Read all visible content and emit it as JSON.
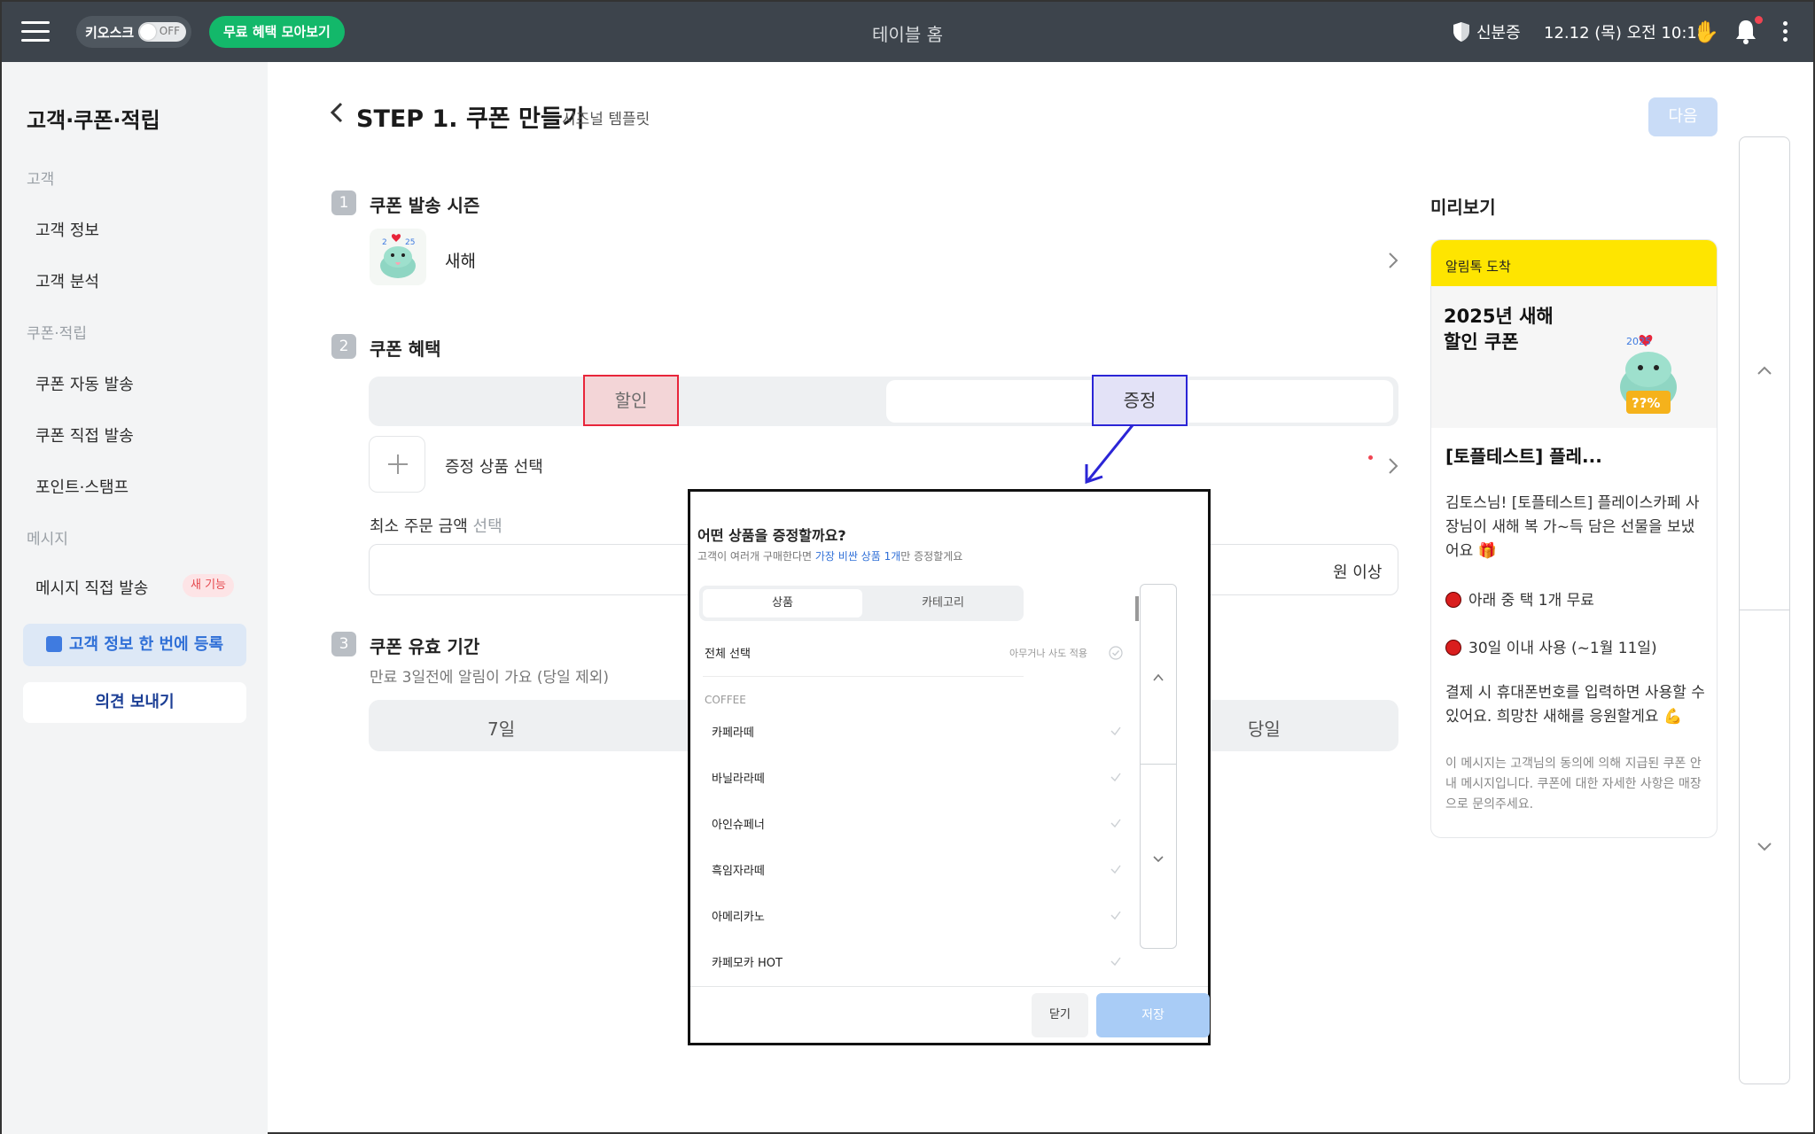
{
  "topbar": {
    "kiosk_label": "키오스크",
    "kiosk_toggle": "OFF",
    "free_benefits_button": "무료 혜택 모아보기",
    "title": "테이블 홈",
    "store_name": "신분증",
    "datetime": "12.12 (목) 오전 10:18",
    "icons": [
      "menu-icon",
      "shield-icon",
      "wave-hand-icon",
      "bell-icon",
      "more-vertical-icon"
    ]
  },
  "sidebar": {
    "title": "고객·쿠폰·적립",
    "sections": [
      {
        "label": "고객",
        "items": [
          "고객 정보",
          "고객 분석"
        ]
      },
      {
        "label": "쿠폰·적립",
        "items": [
          "쿠폰 자동 발송",
          "쿠폰 직접 발송",
          "포인트·스탬프"
        ]
      },
      {
        "label": "메시지",
        "items": [
          "메시지 직접 발송"
        ]
      }
    ],
    "new_badge": "새 기능",
    "register_button": "고객 정보 한 번에 등록",
    "feedback_button": "의견 보내기"
  },
  "main": {
    "step_title": "STEP 1. 쿠폰 만들기",
    "step_subtitle": "시즈널 템플릿",
    "next_button": "다음",
    "sections": [
      {
        "num": "1",
        "title": "쿠폰 발송 시즌"
      },
      {
        "num": "2",
        "title": "쿠폰 혜택"
      },
      {
        "num": "3",
        "title": "쿠폰 유효 기간"
      }
    ],
    "season_value": "새해",
    "benefit_options": [
      "할인",
      "증정"
    ],
    "gift_select_label": "증정 상품 선택",
    "min_order_label": "최소 주문 금액",
    "min_order_optional": "선택",
    "min_order_unit": "원 이상",
    "validity_desc": "만료 3일전에 알림이 가요 (당일 제외)",
    "validity_options": [
      "7일",
      "당일"
    ]
  },
  "preview": {
    "title": "미리보기",
    "header": "알림톡 도착",
    "hero_title_line1": "2025년 새해",
    "hero_title_line2": "할인 쿠폰",
    "hero_badge": "??%",
    "hero_year": "2025",
    "card_title": "[토플테스트] 플레...",
    "body": "김토스님! [토플테스트] 플레이스카페 사장님이 새해 복 가~득 담은 선물을 보냈어요 🎁",
    "bullets": [
      "아래 중 택 1개 무료",
      "30일 이내 사용 (~1월 11일)"
    ],
    "paragraph2": "결제 시 휴대폰번호를 입력하면 사용할 수 있어요. 희망찬 새해를 응원할게요 💪",
    "note": "이 메시지는 고객님의 동의에 의해 지급된 쿠폰 안내 메시지입니다. 쿠폰에 대한 자세한 사항은 매장으로 문의주세요."
  },
  "modal": {
    "title": "어떤 상품을 증정할까요?",
    "subtitle_prefix": "고객이 여러개 구매한다면 ",
    "subtitle_highlight": "가장 비싼 상품 1개",
    "subtitle_suffix": "만 증정할게요",
    "tabs": [
      "상품",
      "카테고리"
    ],
    "select_all": "전체 선택",
    "select_all_hint": "아무거나 사도 적용",
    "category": "COFFEE",
    "items": [
      "카페라떼",
      "바닐라라떼",
      "아인슈페너",
      "흑임자라떼",
      "아메리카노",
      "카페모카 HOT"
    ],
    "close_button": "닫기",
    "save_button": "저장"
  },
  "colors": {
    "topbar": "#3d444c",
    "free_button": "#13b86a",
    "kakao_yellow": "#fee500",
    "annotation_red": "#e8253a",
    "annotation_blue": "#2b25d6",
    "primary_blue": "#2f6fd7"
  }
}
